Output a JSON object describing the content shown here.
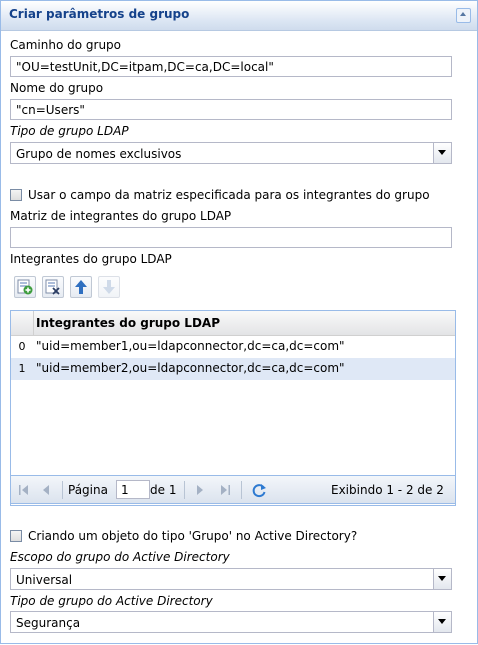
{
  "header": {
    "title": "Criar parâmetros de grupo",
    "collapse_icon": "collapse-up-icon"
  },
  "group_path": {
    "label": "Caminho do grupo",
    "value": "\"OU=testUnit,DC=itpam,DC=ca,DC=local\""
  },
  "group_name": {
    "label": "Nome do grupo",
    "value": "\"cn=Users\""
  },
  "ldap_group_type": {
    "label": "Tipo de grupo LDAP",
    "value": "Grupo de nomes exclusivos"
  },
  "use_array_checkbox": {
    "label": "Usar o campo da matriz especificada para os integrantes do grupo",
    "checked": false
  },
  "member_array": {
    "label": "Matriz de integrantes do grupo LDAP",
    "value": ""
  },
  "members_section": {
    "label": "Integrantes do grupo LDAP"
  },
  "toolbar": {
    "add_icon": "add-row-icon",
    "delete_icon": "delete-row-icon",
    "move_up_icon": "arrow-up-icon",
    "move_down_icon": "arrow-down-icon"
  },
  "grid": {
    "column_header": "Integrantes do grupo LDAP",
    "rows": [
      {
        "index": "0",
        "value": "\"uid=member1,ou=ldapconnector,dc=ca,dc=com\""
      },
      {
        "index": "1",
        "value": "\"uid=member2,ou=ldapconnector,dc=ca,dc=com\""
      }
    ],
    "selected_row": 1
  },
  "pager": {
    "page_label": "Página",
    "page_value": "1",
    "of_label": "de 1",
    "display_text": "Exibindo 1 - 2 de 2",
    "icons": [
      "first-page-icon",
      "prev-page-icon",
      "next-page-icon",
      "last-page-icon",
      "refresh-icon"
    ]
  },
  "ad_checkbox": {
    "label": "Criando um objeto do tipo 'Grupo' no Active Directory?",
    "checked": false
  },
  "ad_scope": {
    "label": "Escopo do grupo do Active Directory",
    "value": "Universal"
  },
  "ad_type": {
    "label": "Tipo de grupo do Active Directory",
    "value": "Segurança"
  },
  "colors": {
    "header_text": "#15428b",
    "border": "#99bbe8",
    "selected_row": "#dfe8f6"
  }
}
